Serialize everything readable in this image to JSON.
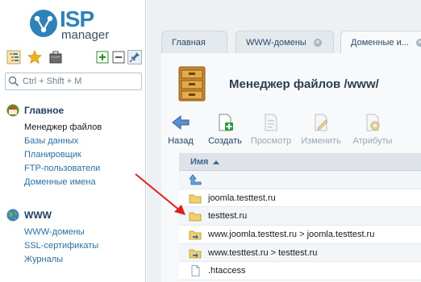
{
  "logo": {
    "brand": "ISP",
    "product": "manager"
  },
  "search": {
    "placeholder": "Ctrl + Shift + M"
  },
  "sidebar": {
    "groups": [
      {
        "title": "Главное",
        "items": [
          {
            "label": "Менеджер файлов",
            "active": true
          },
          {
            "label": "Базы данных"
          },
          {
            "label": "Планировщик"
          },
          {
            "label": "FTP-пользователи"
          },
          {
            "label": "Доменные имена"
          }
        ]
      },
      {
        "title": "WWW",
        "items": [
          {
            "label": "WWW-домены"
          },
          {
            "label": "SSL-сертификаты"
          },
          {
            "label": "Журналы"
          }
        ]
      }
    ]
  },
  "tabs": [
    {
      "label": "Главная"
    },
    {
      "label": "WWW-домены",
      "closable": true
    },
    {
      "label": "Доменные и...",
      "closable": true
    }
  ],
  "page": {
    "title": "Менеджер файлов /www/"
  },
  "toolbar": {
    "back": "Назад",
    "create": "Создать",
    "view": "Просмотр",
    "edit": "Изменить",
    "attrs": "Атрибуты"
  },
  "table": {
    "header": "Имя",
    "rows": [
      {
        "icon": "up-folder-icon",
        "name": ""
      },
      {
        "icon": "folder-icon",
        "name": "joomla.testtest.ru"
      },
      {
        "icon": "folder-icon",
        "name": "testtest.ru"
      },
      {
        "icon": "folder-link-icon",
        "name": "www.joomla.testtest.ru > joomla.testtest.ru"
      },
      {
        "icon": "folder-link-icon",
        "name": "www.testtest.ru > testtest.ru"
      },
      {
        "icon": "file-icon",
        "name": ".htaccess"
      }
    ]
  },
  "colors": {
    "accent": "#2f82b8",
    "link": "#2a6fa3",
    "annotation_arrow": "#e02020"
  }
}
